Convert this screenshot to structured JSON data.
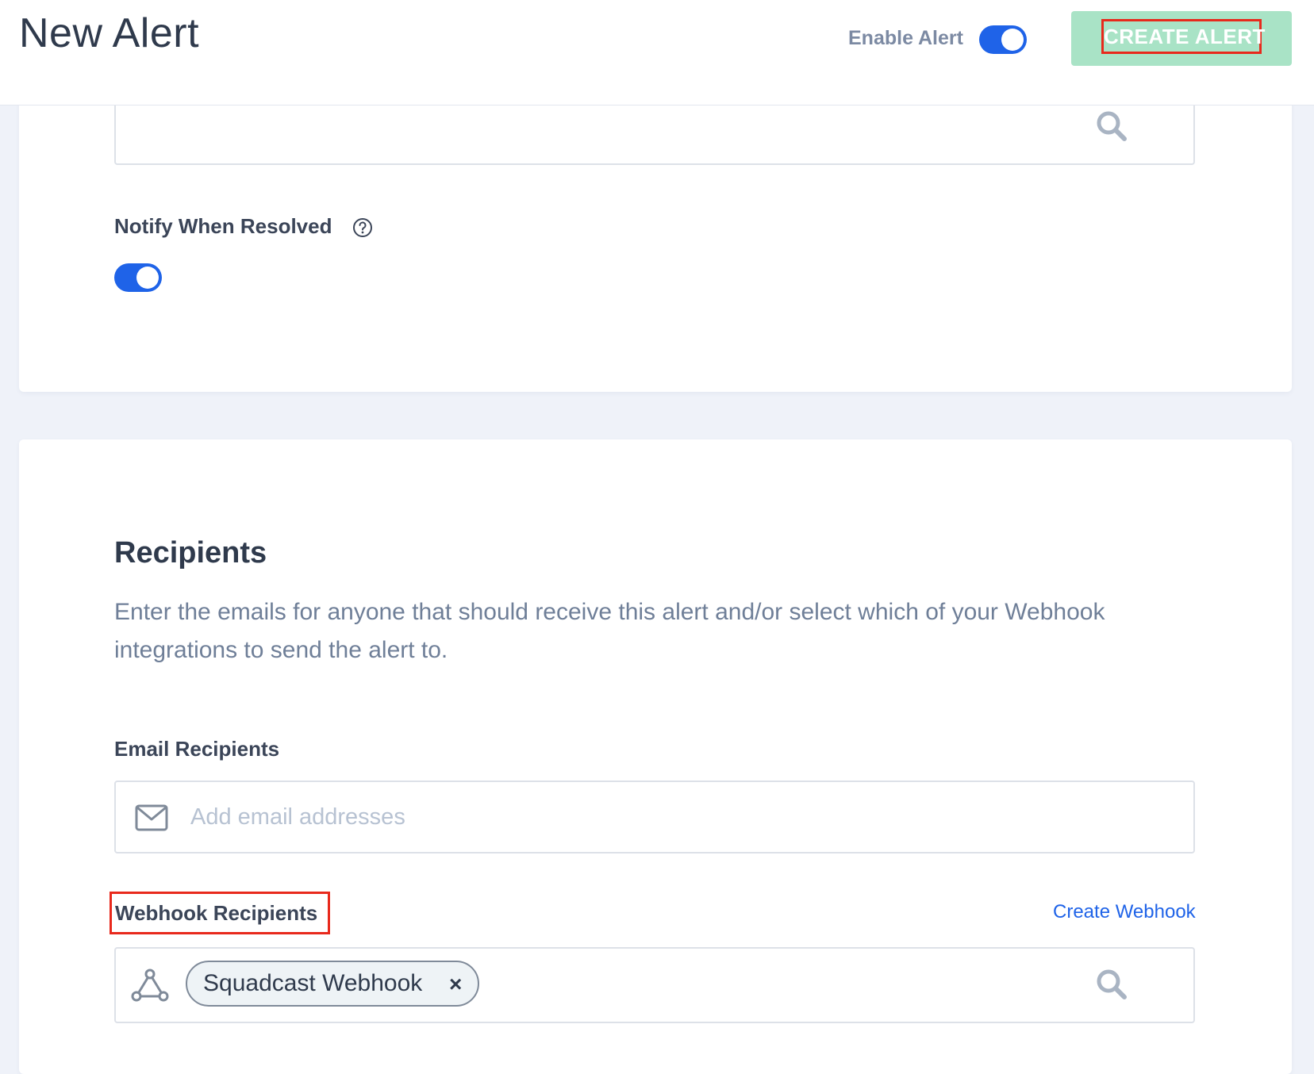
{
  "header": {
    "title": "New Alert",
    "enable_label": "Enable Alert",
    "enable_on": true,
    "create_button": "CREATE ALERT"
  },
  "notify": {
    "label": "Notify When Resolved",
    "enabled": true
  },
  "recipients": {
    "title": "Recipients",
    "description": "Enter the emails for anyone that should receive this alert and/or select which of your Webhook integrations to send the alert to.",
    "email_label": "Email Recipients",
    "email_placeholder": "Add email addresses",
    "webhook_label": "Webhook Recipients",
    "create_webhook": "Create Webhook",
    "webhook_chip": "Squadcast Webhook",
    "chip_remove": "×"
  },
  "colors": {
    "accent_blue": "#1f63e8",
    "create_button_bg": "#a9e3c6",
    "highlight_red": "#e8291c"
  },
  "icons": [
    "search-icon",
    "help-icon",
    "mail-icon",
    "webhook-icon",
    "close-icon"
  ]
}
